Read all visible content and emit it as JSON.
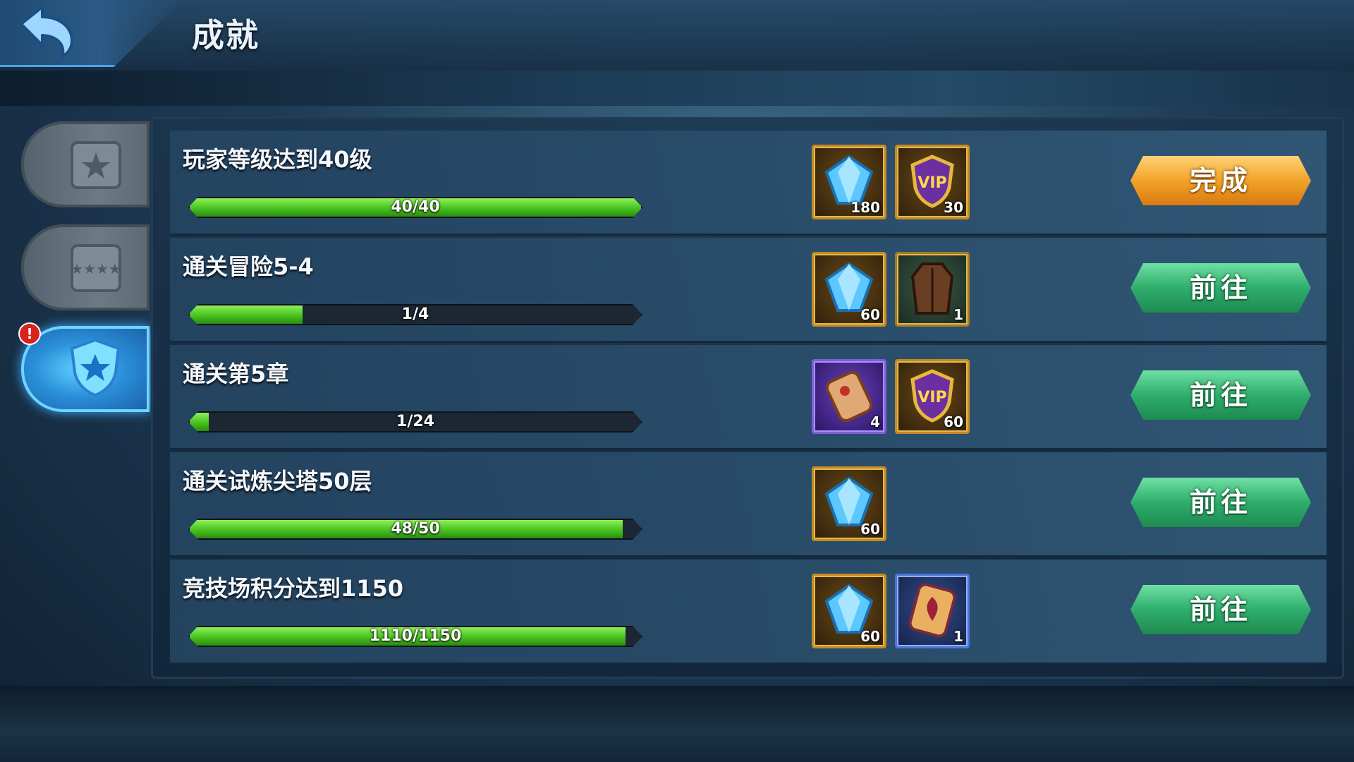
{
  "header": {
    "title": "成就"
  },
  "tabs": [
    {
      "name": "tab-daily",
      "active": false
    },
    {
      "name": "tab-weekly",
      "active": false
    },
    {
      "name": "tab-achievement",
      "active": true,
      "alert": "!"
    }
  ],
  "achievements": [
    {
      "title": "玩家等级达到40级",
      "progress_text": "40/40",
      "progress": 1.0,
      "rewards": [
        {
          "icon": "blue-diamond-icon",
          "count": "180"
        },
        {
          "icon": "vip-badge-icon",
          "count": "30"
        }
      ],
      "button": "完成",
      "button_state": "done"
    },
    {
      "title": "通关冒险5-4",
      "progress_text": "1/4",
      "progress": 0.25,
      "rewards": [
        {
          "icon": "blue-diamond-icon",
          "count": "60"
        },
        {
          "icon": "leather-armor-icon",
          "count": "1"
        }
      ],
      "button": "前往",
      "button_state": "go"
    },
    {
      "title": "通关第5章",
      "progress_text": "1/24",
      "progress": 0.042,
      "rewards": [
        {
          "icon": "scroll-icon",
          "count": "4"
        },
        {
          "icon": "vip-badge-icon",
          "count": "60"
        }
      ],
      "button": "前往",
      "button_state": "go"
    },
    {
      "title": "通关试炼尖塔50层",
      "progress_text": "48/50",
      "progress": 0.96,
      "rewards": [
        {
          "icon": "blue-diamond-icon",
          "count": "60"
        }
      ],
      "button": "前往",
      "button_state": "go"
    },
    {
      "title": "竞技场积分达到1150",
      "progress_text": "1110/1150",
      "progress": 0.965,
      "rewards": [
        {
          "icon": "blue-diamond-icon",
          "count": "60"
        },
        {
          "icon": "emblem-scroll-icon",
          "count": "1"
        }
      ],
      "button": "前往",
      "button_state": "go"
    }
  ],
  "colors": {
    "accent_go": "#2fae6c",
    "accent_done": "#f2a326",
    "progress": "#47c21f"
  }
}
